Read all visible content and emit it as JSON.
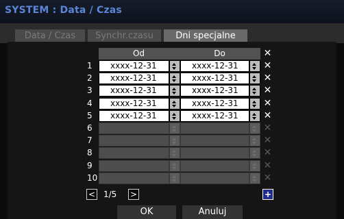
{
  "window": {
    "title": "SYSTEM : Data / Czas"
  },
  "tabs": [
    {
      "label": "Data / Czas",
      "active": false
    },
    {
      "label": "Synchr.czasu",
      "active": false
    },
    {
      "label": "Dni specjalne",
      "active": true
    }
  ],
  "table": {
    "headers": {
      "from": "Od",
      "to": "Do",
      "delete": "✕"
    },
    "rows": [
      {
        "num": "1",
        "from": "xxxx-12-31",
        "to": "xxxx-12-31",
        "enabled": true
      },
      {
        "num": "2",
        "from": "xxxx-12-31",
        "to": "xxxx-12-31",
        "enabled": true
      },
      {
        "num": "3",
        "from": "xxxx-12-31",
        "to": "xxxx-12-31",
        "enabled": true
      },
      {
        "num": "4",
        "from": "xxxx-12-31",
        "to": "xxxx-12-31",
        "enabled": true
      },
      {
        "num": "5",
        "from": "xxxx-12-31",
        "to": "xxxx-12-31",
        "enabled": true
      },
      {
        "num": "6",
        "from": "",
        "to": "",
        "enabled": false
      },
      {
        "num": "7",
        "from": "",
        "to": "",
        "enabled": false
      },
      {
        "num": "8",
        "from": "",
        "to": "",
        "enabled": false
      },
      {
        "num": "9",
        "from": "",
        "to": "",
        "enabled": false
      },
      {
        "num": "10",
        "from": "",
        "to": "",
        "enabled": false
      }
    ]
  },
  "pagination": {
    "prev": "<",
    "page": "1/5",
    "next": ">",
    "add": "+"
  },
  "footer": {
    "ok": "OK",
    "cancel": "Anuluj"
  },
  "colors": {
    "title": "#5b86d8",
    "active_tab": "#6a6a6a",
    "add_button": "#1f2c8a"
  },
  "icons": {
    "spinner": "up-down-spinner-icon",
    "delete": "close-x-icon",
    "add": "plus-icon",
    "prev": "chevron-left-icon",
    "next": "chevron-right-icon"
  }
}
